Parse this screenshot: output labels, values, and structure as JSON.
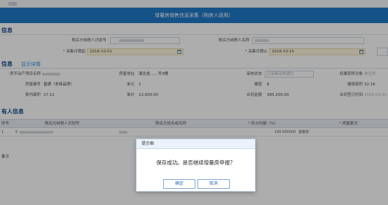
{
  "top_strip": {
    "label": "明细"
  },
  "form_header": {
    "title": "增量房销售信息采集（购房人适用）"
  },
  "basic_info": {
    "section_title": "信息",
    "buyer_id_label": "购买方纳税人识别号",
    "buyer_name_label": "购买方纳税人名称",
    "collect_start_label": "采集日期起",
    "collect_start_value": "2018-10-01",
    "collect_end_label": "采集日期止",
    "collect_end_value": "2018-10-15"
  },
  "house_info": {
    "section_title": "信息",
    "detail_link": "显示详情",
    "rows": [
      [
        {
          "label": "房不动产项目名称",
          "value": ""
        },
        {
          "label": "房屋地址",
          "value": "湖北省……号3幢"
        },
        {
          "label": "审核状态",
          "value": "已采集审核通过"
        },
        {
          "label": "权属转移对象",
          "value": "单位房"
        }
      ],
      [
        {
          "label": "房屋编号",
          "value": "普通（非商品房）"
        },
        {
          "label": "单元",
          "value": "1"
        },
        {
          "label": "楼层",
          "value": "8"
        },
        {
          "label": "建筑面积",
          "value": "32.16"
        }
      ],
      [
        {
          "label": "套内面积",
          "value": "27.12"
        },
        {
          "label": "单价",
          "value": "12,000.00"
        },
        {
          "label": "合同金额",
          "value": "385,200.00"
        },
        {
          "label": "合同签订时间",
          "value": "2018-09-30"
        }
      ]
    ]
  },
  "owner_info": {
    "section_title": "有人信息",
    "columns": [
      "序号",
      "购买方纳税人识别号",
      "购买方姓名或名称",
      "所占份额（%）",
      "房屋套次"
    ],
    "rows": [
      {
        "index": "1",
        "id": "5",
        "name": "",
        "share": "100.000000",
        "suite": "首套房"
      }
    ]
  },
  "footer_note": "备注",
  "dialog": {
    "title": "提示框",
    "message": "保存成功。是否继续增量房申报？",
    "ok_label": "确定",
    "cancel_label": "取消"
  }
}
